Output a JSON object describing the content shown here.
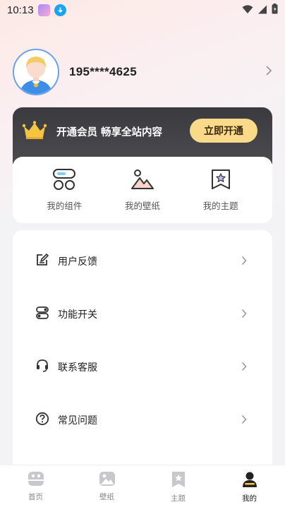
{
  "status_bar": {
    "time": "10:13"
  },
  "profile": {
    "phone": "195****4625"
  },
  "vip": {
    "text": "开通会员 畅享全站内容",
    "button_label": "立即开通"
  },
  "quick_actions": [
    {
      "label": "我的组件",
      "icon": "widgets-icon"
    },
    {
      "label": "我的壁纸",
      "icon": "wallpaper-icon"
    },
    {
      "label": "我的主题",
      "icon": "theme-icon"
    }
  ],
  "menu": [
    {
      "label": "用户反馈",
      "icon": "feedback-icon"
    },
    {
      "label": "功能开关",
      "icon": "toggle-icon"
    },
    {
      "label": "联系客服",
      "icon": "headset-icon"
    },
    {
      "label": "常见问题",
      "icon": "help-icon"
    }
  ],
  "tabs": [
    {
      "label": "首页",
      "icon": "home-icon",
      "active": false
    },
    {
      "label": "壁纸",
      "icon": "wallpaper-tab-icon",
      "active": false
    },
    {
      "label": "主题",
      "icon": "theme-tab-icon",
      "active": false
    },
    {
      "label": "我的",
      "icon": "profile-tab-icon",
      "active": true
    }
  ],
  "colors": {
    "vip_button": "#f9d98a",
    "vip_banner": "#3f3f44",
    "accent_blue": "#1aa3f0",
    "tab_inactive": "#c8c8cc",
    "tab_active": "#222222"
  }
}
